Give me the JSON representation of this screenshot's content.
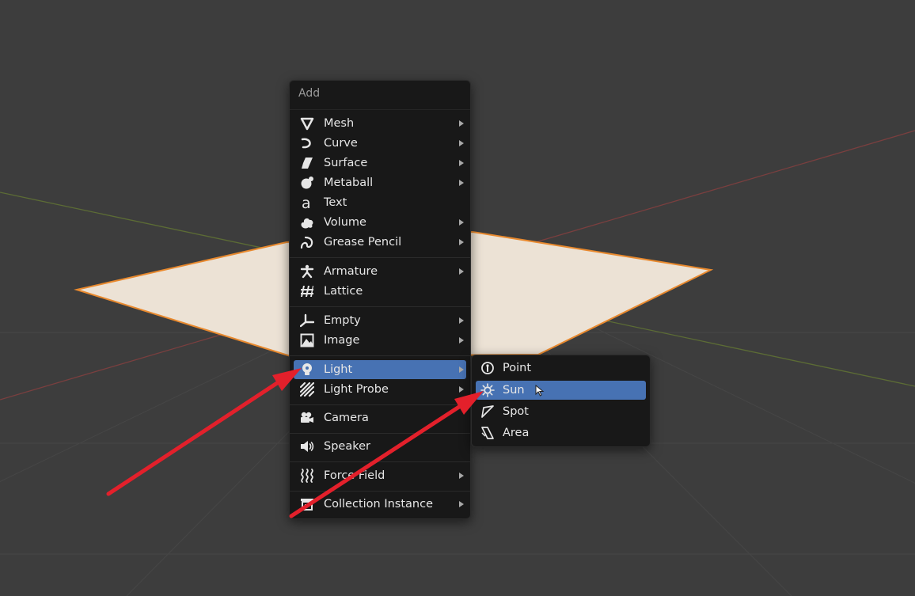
{
  "add_menu": {
    "title": "Add",
    "items": [
      {
        "label": "Mesh",
        "icon": "mesh-icon",
        "submenu": true
      },
      {
        "label": "Curve",
        "icon": "curve-icon",
        "submenu": true
      },
      {
        "label": "Surface",
        "icon": "surface-icon",
        "submenu": true
      },
      {
        "label": "Metaball",
        "icon": "metaball-icon",
        "submenu": true
      },
      {
        "label": "Text",
        "icon": "text-icon",
        "submenu": false
      },
      {
        "label": "Volume",
        "icon": "volume-icon",
        "submenu": true
      },
      {
        "label": "Grease Pencil",
        "icon": "grease-pencil-icon",
        "submenu": true
      },
      {
        "label": "Armature",
        "icon": "armature-icon",
        "submenu": true
      },
      {
        "label": "Lattice",
        "icon": "lattice-icon",
        "submenu": false
      },
      {
        "label": "Empty",
        "icon": "empty-icon",
        "submenu": true
      },
      {
        "label": "Image",
        "icon": "image-icon",
        "submenu": true
      },
      {
        "label": "Light",
        "icon": "light-icon",
        "submenu": true,
        "highlighted": true
      },
      {
        "label": "Light Probe",
        "icon": "light-probe-icon",
        "submenu": true
      },
      {
        "label": "Camera",
        "icon": "camera-icon",
        "submenu": false
      },
      {
        "label": "Speaker",
        "icon": "speaker-icon",
        "submenu": false
      },
      {
        "label": "Force Field",
        "icon": "force-field-icon",
        "submenu": true
      },
      {
        "label": "Collection Instance",
        "icon": "collection-instance-icon",
        "submenu": true
      }
    ]
  },
  "light_menu": {
    "items": [
      {
        "label": "Point",
        "icon": "point-light-icon"
      },
      {
        "label": "Sun",
        "icon": "sun-light-icon",
        "highlighted": true
      },
      {
        "label": "Spot",
        "icon": "spot-light-icon"
      },
      {
        "label": "Area",
        "icon": "area-light-icon"
      }
    ]
  },
  "colors": {
    "menu_bg": "#181818",
    "highlight": "#4772b3",
    "viewport_bg": "#3d3d3d",
    "plane_fill": "#ece2d5",
    "plane_outline": "#e8892e",
    "annotation_arrow": "#e3202b"
  },
  "annotations": [
    "red-arrow-to-light",
    "red-arrow-to-sun"
  ]
}
